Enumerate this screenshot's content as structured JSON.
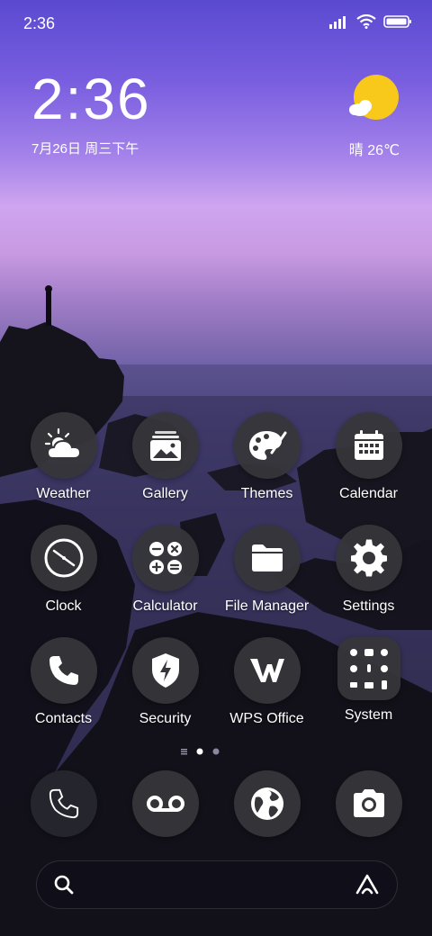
{
  "status_bar": {
    "time": "2:36"
  },
  "clock_widget": {
    "time": "2:36",
    "date": "7月26日 周三下午"
  },
  "weather_widget": {
    "temperature": "晴 26℃"
  },
  "apps": [
    {
      "label": "Weather"
    },
    {
      "label": "Gallery"
    },
    {
      "label": "Themes"
    },
    {
      "label": "Calendar"
    },
    {
      "label": "Clock"
    },
    {
      "label": "Calculator"
    },
    {
      "label": "File Manager"
    },
    {
      "label": "Settings"
    },
    {
      "label": "Contacts"
    },
    {
      "label": "Security"
    },
    {
      "label": "WPS Office"
    },
    {
      "label": "System"
    }
  ],
  "dock": [
    {
      "icon": "phone-icon"
    },
    {
      "icon": "voicemail-icon"
    },
    {
      "icon": "browser-globe-icon"
    },
    {
      "icon": "camera-icon"
    }
  ],
  "colors": {
    "icon_bg": "#36363a",
    "sun": "#f8c81a",
    "accent_white": "#ffffff"
  }
}
